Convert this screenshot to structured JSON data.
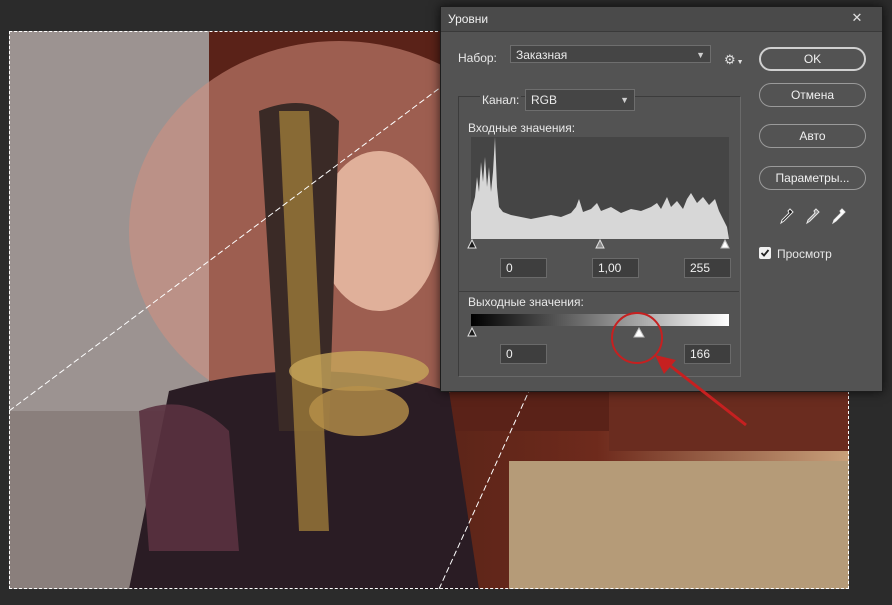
{
  "dialog": {
    "title": "Уровни",
    "close_symbol": "✕",
    "preset_label": "Набор:",
    "preset_value": "Заказная",
    "channel_label": "Канал:",
    "channel_value": "RGB",
    "input_levels_label": "Входные значения:",
    "input_black": "0",
    "input_gamma": "1,00",
    "input_white": "255",
    "output_levels_label": "Выходные значения:",
    "output_black": "0",
    "output_white": "166",
    "preview_label": "Просмотр",
    "preview_checked": true
  },
  "buttons": {
    "ok": "OK",
    "cancel": "Отмена",
    "auto": "Авто",
    "options": "Параметры..."
  },
  "icons": {
    "settings": "gear-icon",
    "dropdown": "chevron-down-icon",
    "eyedroppers": [
      "black-point-eyedropper-icon",
      "gray-point-eyedropper-icon",
      "white-point-eyedropper-icon"
    ]
  },
  "colors": {
    "dialog_bg": "#535353",
    "annotation": "#c62020"
  }
}
